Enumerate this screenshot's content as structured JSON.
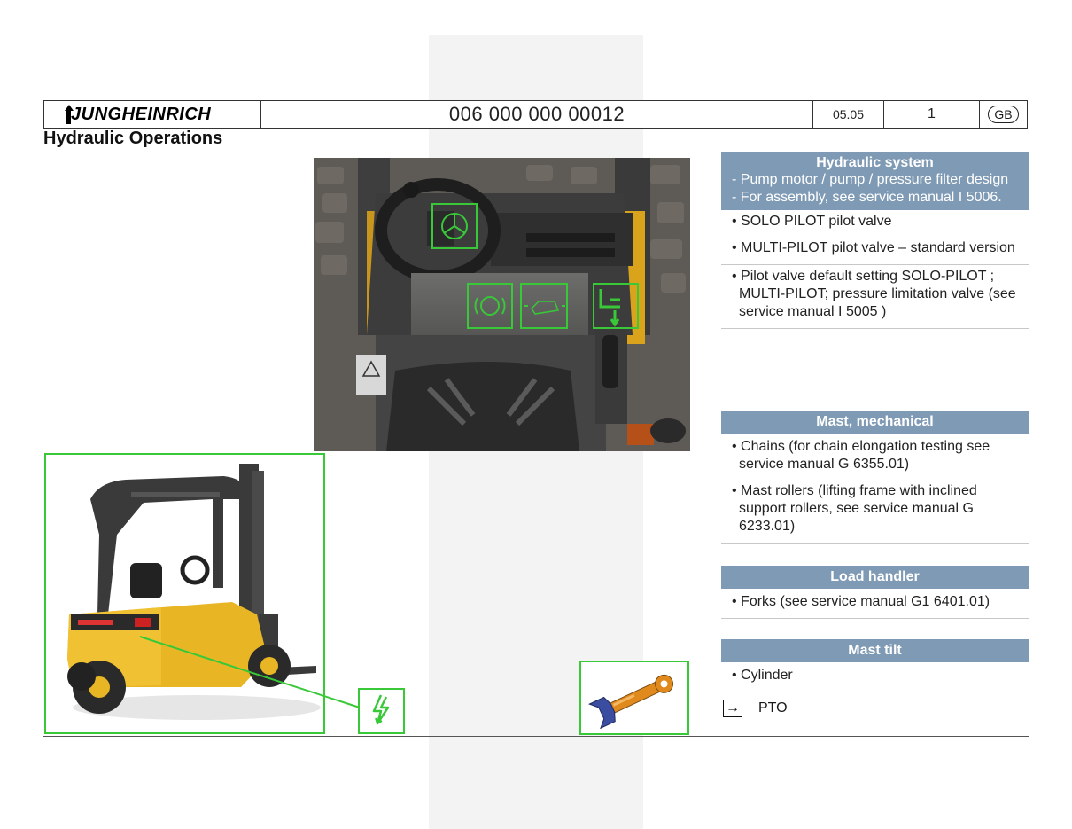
{
  "header": {
    "brand": "JUNGHEINRICH",
    "doc_number": "006 000 000 00012",
    "date": "05.05",
    "page": "1",
    "language": "GB"
  },
  "page_title": "Hydraulic Operations",
  "sections": {
    "hydraulic_system": {
      "title": "Hydraulic system",
      "sub": [
        "- Pump motor / pump / pressure filter design",
        "- For assembly, see service manual I 5006."
      ],
      "items": [
        "• SOLO PILOT pilot valve",
        "• MULTI-PILOT pilot valve – standard version",
        "• Pilot valve default setting SOLO-PILOT ; MULTI-PILOT; pressure limitation valve (see service manual I 5005 )"
      ]
    },
    "mast_mechanical": {
      "title": "Mast, mechanical",
      "items": [
        "• Chains (for chain elongation testing see service manual G 6355.01)",
        "• Mast rollers (lifting frame with inclined support rollers, see service manual G 6233.01)"
      ]
    },
    "load_handler": {
      "title": "Load handler",
      "items": [
        "• Forks (see service manual G1 6401.01)"
      ]
    },
    "mast_tilt": {
      "title": "Mast tilt",
      "items": [
        "• Cylinder"
      ]
    },
    "pto": {
      "label": "PTO"
    }
  },
  "icons": {
    "steering": "steering-wheel-icon",
    "brake": "brake-icon",
    "drive": "drive-icon",
    "hydraulic_lever": "hydraulic-lever-icon",
    "electrical": "lightning-icon",
    "wrench": "wrench-icon",
    "link_arrow": "arrow-right-icon"
  },
  "colors": {
    "section_header": "#7f9ab4",
    "highlight_frame": "#38c838",
    "truck_body": "#e8b624"
  }
}
